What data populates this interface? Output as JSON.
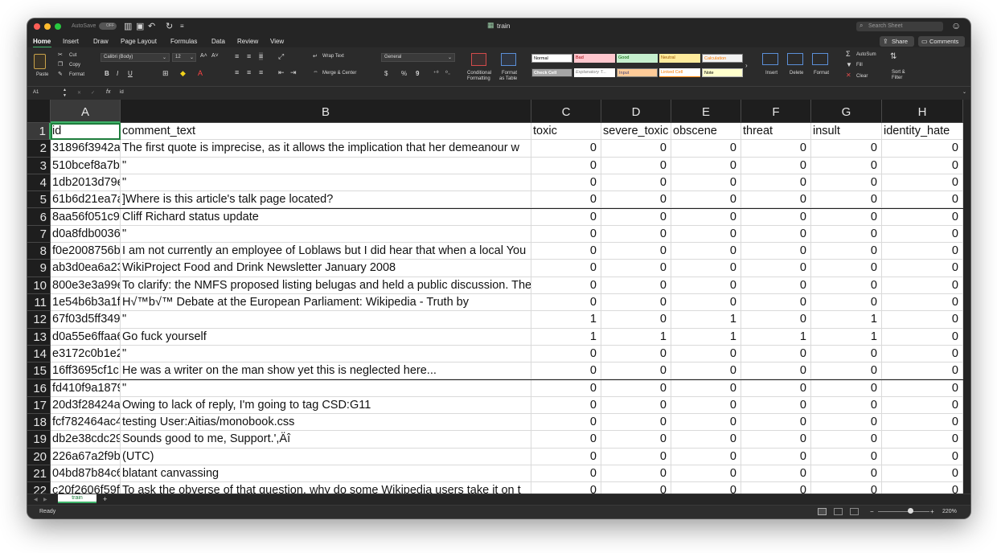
{
  "titlebar": {
    "autosave_label": "AutoSave",
    "autosave_state": "OFF",
    "filename": "train",
    "search_placeholder": "Search Sheet"
  },
  "menu": [
    "Home",
    "Insert",
    "Draw",
    "Page Layout",
    "Formulas",
    "Data",
    "Review",
    "View"
  ],
  "share_label": "Share",
  "comments_label": "Comments",
  "ribbon": {
    "clipboard": {
      "paste": "Paste",
      "cut": "Cut",
      "copy": "Copy",
      "format": "Format"
    },
    "font": {
      "name": "Calibri (Body)",
      "size": "12",
      "bold": "B",
      "italic": "I",
      "underline": "U"
    },
    "alignment": {
      "wrap": "Wrap Text",
      "merge": "Merge & Center"
    },
    "number": {
      "format": "General",
      "currency": "$",
      "percent": "%",
      "comma": "9"
    },
    "styles": {
      "conditional_l1": "Conditional",
      "conditional_l2": "Formatting",
      "format_table_l1": "Format",
      "format_table_l2": "as Table",
      "items": [
        "Normal",
        "Bad",
        "Good",
        "Neutral",
        "Calculation",
        "Check Cell",
        "Explanatory T...",
        "Input",
        "Linked Cell",
        "Note"
      ]
    },
    "cells": {
      "insert": "Insert",
      "delete": "Delete",
      "format": "Format"
    },
    "editing": {
      "autosum": "AutoSum",
      "fill": "Fill",
      "clear": "Clear",
      "sort_l1": "Sort &",
      "sort_l2": "Filter"
    }
  },
  "formula_bar": {
    "cell_ref": "A1",
    "fx": "fx",
    "content": "id"
  },
  "columns": [
    "A",
    "B",
    "C",
    "D",
    "E",
    "F",
    "G",
    "H"
  ],
  "rows": [
    {
      "n": "1",
      "id": "id",
      "text": "comment_text",
      "v": [
        "toxic",
        "severe_toxic",
        "obscene",
        "threat",
        "insult",
        "identity_hate"
      ]
    },
    {
      "n": "2",
      "id": "31896f3942a",
      "text": "The first quote is imprecise, as it allows the implication that her demeanour w",
      "v": [
        "0",
        "0",
        "0",
        "0",
        "0",
        "0"
      ]
    },
    {
      "n": "3",
      "id": "510bcef8a7b",
      "text": "\"",
      "v": [
        "0",
        "0",
        "0",
        "0",
        "0",
        "0"
      ]
    },
    {
      "n": "4",
      "id": "1db2013d79e",
      "text": "\"",
      "v": [
        "0",
        "0",
        "0",
        "0",
        "0",
        "0"
      ]
    },
    {
      "n": "5",
      "id": "61b6d21ea7a",
      "text": "]Where is this article's talk page located?",
      "v": [
        "0",
        "0",
        "0",
        "0",
        "0",
        "0"
      ]
    },
    {
      "n": "6",
      "id": "8aa56f051c9",
      "text": "Cliff Richard status update",
      "v": [
        "0",
        "0",
        "0",
        "0",
        "0",
        "0"
      ]
    },
    {
      "n": "7",
      "id": "d0a8fdb0036",
      "text": "\"",
      "v": [
        "0",
        "0",
        "0",
        "0",
        "0",
        "0"
      ]
    },
    {
      "n": "8",
      "id": "f0e2008756b",
      "text": "I am not currently an employee of Loblaws but I did hear that when a local You",
      "v": [
        "0",
        "0",
        "0",
        "0",
        "0",
        "0"
      ]
    },
    {
      "n": "9",
      "id": "ab3d0ea6a23",
      "text": "WikiProject Food and Drink Newsletter January 2008",
      "v": [
        "0",
        "0",
        "0",
        "0",
        "0",
        "0"
      ]
    },
    {
      "n": "10",
      "id": "800e3e3a99e",
      "text": "To clarify: the NMFS proposed listing belugas and held a public discussion. The",
      "v": [
        "0",
        "0",
        "0",
        "0",
        "0",
        "0"
      ]
    },
    {
      "n": "11",
      "id": "1e54b6b3a1f",
      "text": "H√™b√™ Debate at the European Parliament: Wikipedia - Truth by",
      "v": [
        "0",
        "0",
        "0",
        "0",
        "0",
        "0"
      ]
    },
    {
      "n": "12",
      "id": "67f03d5ff349",
      "text": "\"",
      "v": [
        "1",
        "0",
        "1",
        "0",
        "1",
        "0"
      ]
    },
    {
      "n": "13",
      "id": "d0a55e6ffaa6",
      "text": "Go fuck yourself",
      "v": [
        "1",
        "1",
        "1",
        "1",
        "1",
        "0"
      ]
    },
    {
      "n": "14",
      "id": "e3172c0b1e2",
      "text": "\"",
      "v": [
        "0",
        "0",
        "0",
        "0",
        "0",
        "0"
      ]
    },
    {
      "n": "15",
      "id": "16ff3695cf1c",
      "text": "He was a writer on the man show yet this is neglected here...",
      "v": [
        "0",
        "0",
        "0",
        "0",
        "0",
        "0"
      ]
    },
    {
      "n": "16",
      "id": "fd410f9a1879",
      "text": "\"",
      "v": [
        "0",
        "0",
        "0",
        "0",
        "0",
        "0"
      ]
    },
    {
      "n": "17",
      "id": "20d3f28424a",
      "text": "Owing to lack of reply, I'm going to tag CSD:G11",
      "v": [
        "0",
        "0",
        "0",
        "0",
        "0",
        "0"
      ]
    },
    {
      "n": "18",
      "id": "fcf782464ac4",
      "text": "testing User:Aitias/monobook.css",
      "v": [
        "0",
        "0",
        "0",
        "0",
        "0",
        "0"
      ]
    },
    {
      "n": "19",
      "id": "db2e38cdc29",
      "text": "Sounds good to me, Support.',Äî",
      "v": [
        "0",
        "0",
        "0",
        "0",
        "0",
        "0"
      ]
    },
    {
      "n": "20",
      "id": "226a67a2f9b",
      "text": "(UTC)",
      "v": [
        "0",
        "0",
        "0",
        "0",
        "0",
        "0"
      ]
    },
    {
      "n": "21",
      "id": "04bd87b84c6",
      "text": "blatant canvassing",
      "v": [
        "0",
        "0",
        "0",
        "0",
        "0",
        "0"
      ]
    },
    {
      "n": "22",
      "id": "c20f2606f59f",
      "text": "To ask the obverse of that question, why do some Wikipedia users take it on t",
      "v": [
        "0",
        "0",
        "0",
        "0",
        "0",
        "0"
      ]
    }
  ],
  "sheet_tabs": [
    "train"
  ],
  "add_sheet": "+",
  "status": {
    "text": "Ready",
    "zoom": "220%"
  }
}
